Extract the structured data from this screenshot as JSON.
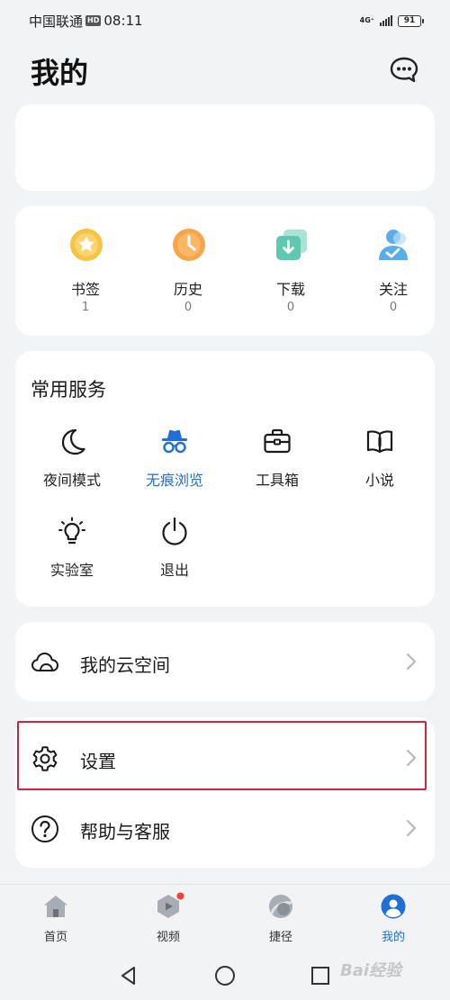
{
  "status_bar": {
    "carrier": "中国联通",
    "hd": "HD",
    "time": "08:11",
    "network": "4G⁺",
    "battery": "91"
  },
  "page": {
    "title": "我的"
  },
  "stats": [
    {
      "label": "书签",
      "count": "1",
      "icon": "bookmark-star-icon",
      "color": "#f6c343"
    },
    {
      "label": "历史",
      "count": "0",
      "icon": "history-clock-icon",
      "color": "#f5a54a"
    },
    {
      "label": "下载",
      "count": "0",
      "icon": "download-icon",
      "color": "#5ec9b0"
    },
    {
      "label": "关注",
      "count": "0",
      "icon": "follow-person-icon",
      "color": "#5aaee8"
    }
  ],
  "services": {
    "title": "常用服务",
    "items": [
      {
        "label": "夜间模式",
        "icon": "moon-icon"
      },
      {
        "label": "无痕浏览",
        "icon": "incognito-icon",
        "active": true
      },
      {
        "label": "工具箱",
        "icon": "toolbox-icon"
      },
      {
        "label": "小说",
        "icon": "book-icon"
      },
      {
        "label": "实验室",
        "icon": "lightbulb-icon"
      },
      {
        "label": "退出",
        "icon": "power-icon"
      }
    ]
  },
  "rows": {
    "cloud": {
      "label": "我的云空间",
      "icon": "cloud-icon"
    },
    "settings": {
      "label": "设置",
      "icon": "gear-icon"
    },
    "help": {
      "label": "帮助与客服",
      "icon": "help-icon"
    }
  },
  "bottom_nav": [
    {
      "label": "首页",
      "icon": "home-icon"
    },
    {
      "label": "视频",
      "icon": "video-icon",
      "badge": true
    },
    {
      "label": "捷径",
      "icon": "shortcut-icon"
    },
    {
      "label": "我的",
      "icon": "profile-icon",
      "active": true
    }
  ],
  "watermark": "Bai经验",
  "colors": {
    "accent": "#1f6fd6",
    "highlight": "#d0243a",
    "badge": "#e8453c"
  }
}
